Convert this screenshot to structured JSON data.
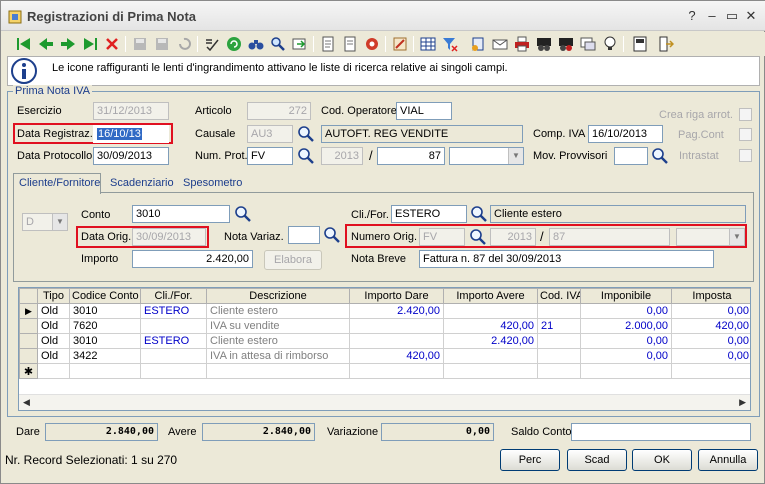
{
  "window": {
    "title": "Registrazioni di Prima Nota"
  },
  "info": {
    "text": "Le icone raffiguranti le lenti d'ingrandimento attivano le liste di ricerca relative ai singoli campi."
  },
  "group": {
    "title": "Prima Nota IVA"
  },
  "header": {
    "esercizio_label": "Esercizio",
    "esercizio_value": "31/12/2013",
    "data_registraz_label": "Data Registraz.",
    "data_registraz_value": "16/10/13",
    "data_protocollo_label": "Data Protocollo",
    "data_protocollo_value": "30/09/2013",
    "articolo_label": "Articolo",
    "articolo_value": "272",
    "causale_label": "Causale",
    "causale_value": "AU3",
    "num_prot_label": "Num. Prot.",
    "num_prot_value": "FV",
    "cod_operatore_label": "Cod. Operatore",
    "cod_operatore_value": "VIAL",
    "causale_descr": "AUTOFT. REG VENDITE",
    "prot_year": "2013",
    "prot_slash": "/",
    "prot_number": "87",
    "comp_iva_label": "Comp. IVA",
    "comp_iva_value": "16/10/2013",
    "mov_provvisori_label": "Mov. Provvisori",
    "crea_riga_label": "Crea riga arrot.",
    "pag_cont_label": "Pag.Cont",
    "intrastat_label": "Intrastat"
  },
  "tabs": [
    {
      "label": "Cliente/Fornitore"
    },
    {
      "label": "Scadenziario"
    },
    {
      "label": "Spesometro"
    }
  ],
  "cliente": {
    "dc_value": "D",
    "conto_label": "Conto",
    "conto_value": "3010",
    "cli_for_label": "Cli./For.",
    "cli_for_value": "ESTERO",
    "cli_for_descr": "Cliente estero",
    "data_orig_label": "Data Orig.",
    "data_orig_value": "30/09/2013",
    "nota_variaz_label": "Nota Variaz.",
    "numero_orig_label": "Numero Orig.",
    "numero_orig_prefix": "FV",
    "numero_orig_year": "2013",
    "numero_orig_slash": "/",
    "numero_orig_number": "87",
    "importo_label": "Importo",
    "importo_value": "2.420,00",
    "elabora_label": "Elabora",
    "nota_breve_label": "Nota Breve",
    "nota_breve_value": "Fattura n. 87 del 30/09/2013"
  },
  "grid": {
    "columns": [
      "Tipo",
      "Codice Conto",
      "Cli./For.",
      "Descrizione",
      "Importo Dare",
      "Importo Avere",
      "Cod. IVA",
      "Imponibile",
      "Imposta"
    ],
    "rows": [
      {
        "tipo": "Old",
        "conto": "3010",
        "clifor": "ESTERO",
        "descr": "Cliente estero",
        "dare": "2.420,00",
        "avere": "",
        "iva": "",
        "imponibile": "0,00",
        "imposta": "0,00"
      },
      {
        "tipo": "Old",
        "conto": "7620",
        "clifor": "",
        "descr": "IVA su vendite",
        "dare": "",
        "avere": "420,00",
        "iva": "21",
        "imponibile": "2.000,00",
        "imposta": "420,00"
      },
      {
        "tipo": "Old",
        "conto": "3010",
        "clifor": "ESTERO",
        "descr": "Cliente estero",
        "dare": "",
        "avere": "2.420,00",
        "iva": "",
        "imponibile": "0,00",
        "imposta": "0,00"
      },
      {
        "tipo": "Old",
        "conto": "3422",
        "clifor": "",
        "descr": "IVA in attesa di rimborso",
        "dare": "420,00",
        "avere": "",
        "iva": "",
        "imponibile": "0,00",
        "imposta": "0,00"
      }
    ]
  },
  "totals": {
    "dare_label": "Dare",
    "dare_value": "2.840,00",
    "avere_label": "Avere",
    "avere_value": "2.840,00",
    "variazione_label": "Variazione",
    "variazione_value": "0,00",
    "saldo_label": "Saldo Conto"
  },
  "status": {
    "text": "Nr. Record Selezionati: 1 su 270"
  },
  "buttons": {
    "perc": "Perc",
    "scad": "Scad",
    "ok": "OK",
    "annulla": "Annulla"
  }
}
